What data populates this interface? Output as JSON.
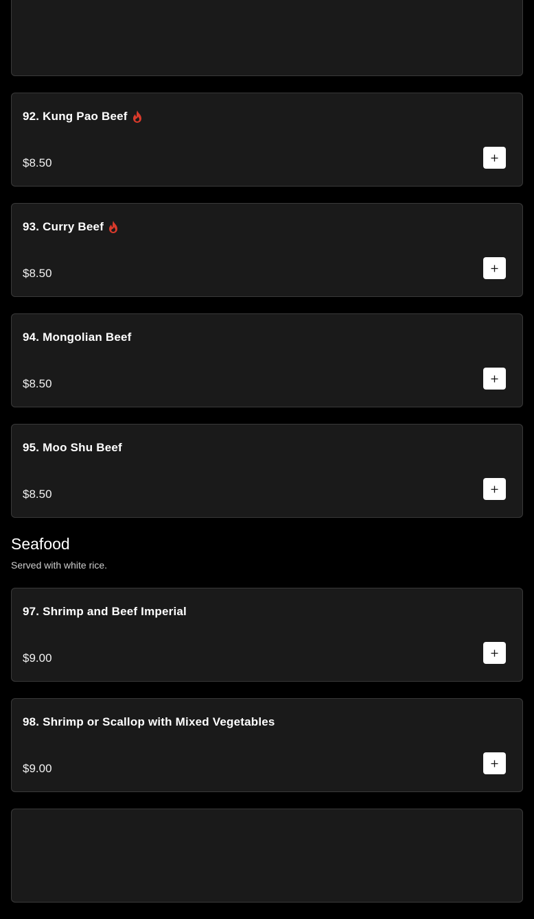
{
  "colors": {
    "background": "#000000",
    "card": "#1a1a1a",
    "card_border": "#3a3a3a",
    "spicy_icon": "#d93a2b",
    "add_button": "#ffffff"
  },
  "beef_items": [
    {
      "title": "",
      "price": ""
    },
    {
      "title": "92. Kung Pao Beef",
      "price": "$8.50",
      "spicy": true
    },
    {
      "title": "93. Curry Beef",
      "price": "$8.50",
      "spicy": true
    },
    {
      "title": "94. Mongolian Beef",
      "price": "$8.50",
      "spicy": false
    },
    {
      "title": "95. Moo Shu Beef",
      "price": "$8.50",
      "spicy": false
    }
  ],
  "seafood": {
    "title": "Seafood",
    "description": "Served with white rice.",
    "items": [
      {
        "title": "97. Shrimp and Beef Imperial",
        "price": "$9.00",
        "spicy": false
      },
      {
        "title": "98. Shrimp or Scallop with Mixed Vegetables",
        "price": "$9.00",
        "spicy": false
      },
      {
        "title": "",
        "price": ""
      }
    ]
  },
  "icons": {
    "spicy": "flame-icon",
    "add": "plus-icon"
  }
}
